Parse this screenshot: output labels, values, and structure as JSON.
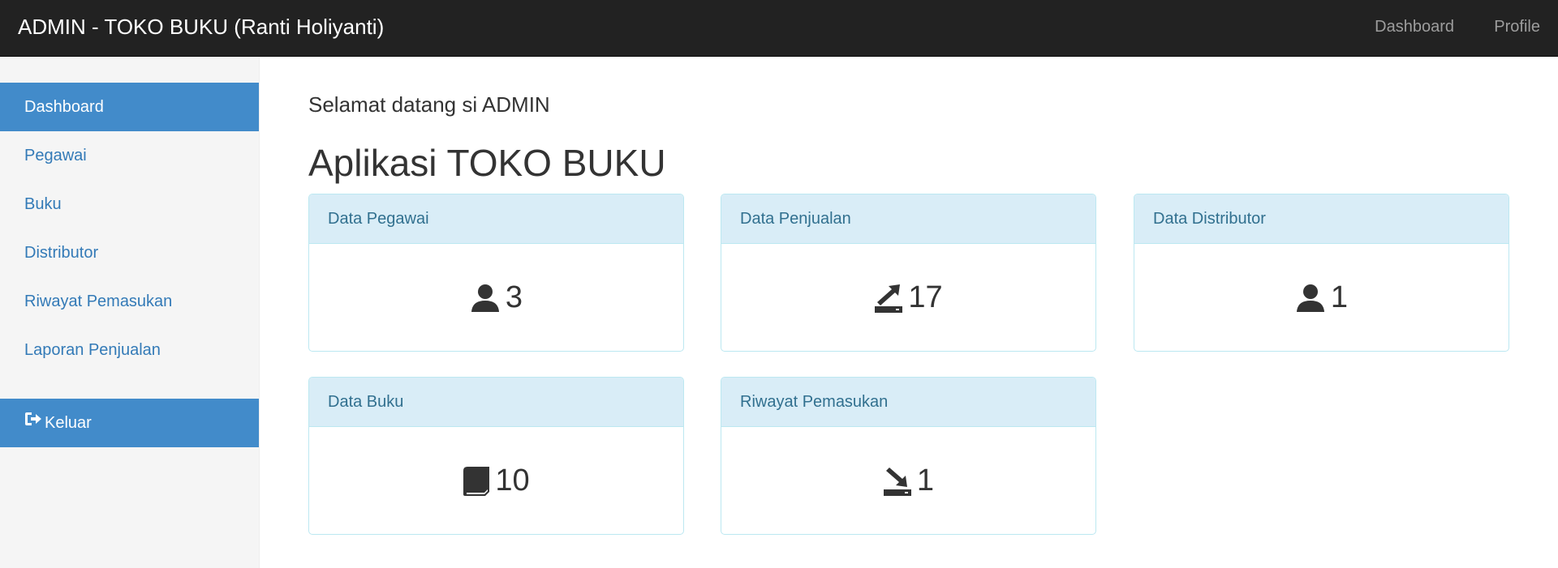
{
  "navbar": {
    "brand": "ADMIN - TOKO BUKU (Ranti Holiyanti)",
    "links": [
      "Dashboard",
      "Profile"
    ]
  },
  "sidebar": {
    "items": [
      {
        "label": "Dashboard",
        "active": true
      },
      {
        "label": "Pegawai"
      },
      {
        "label": "Buku"
      },
      {
        "label": "Distributor"
      },
      {
        "label": "Riwayat Pemasukan"
      },
      {
        "label": "Laporan Penjualan"
      }
    ],
    "logout": {
      "label": "Keluar",
      "icon": "log-out-icon"
    }
  },
  "main": {
    "welcome": "Selamat datang si ADMIN",
    "title": "Aplikasi TOKO BUKU",
    "panels": [
      {
        "heading": "Data Pegawai",
        "value": "3",
        "icon": "user-icon"
      },
      {
        "heading": "Data Penjualan",
        "value": "17",
        "icon": "export-icon"
      },
      {
        "heading": "Data Distributor",
        "value": "1",
        "icon": "user-icon"
      },
      {
        "heading": "Data Buku",
        "value": "10",
        "icon": "book-icon"
      },
      {
        "heading": "Riwayat Pemasukan",
        "value": "1",
        "icon": "import-icon"
      }
    ]
  },
  "colors": {
    "navbar_bg": "#222222",
    "sidebar_active": "#428bca",
    "panel_heading_bg": "#d9edf7",
    "panel_border": "#bce8f1",
    "link": "#337ab7"
  }
}
